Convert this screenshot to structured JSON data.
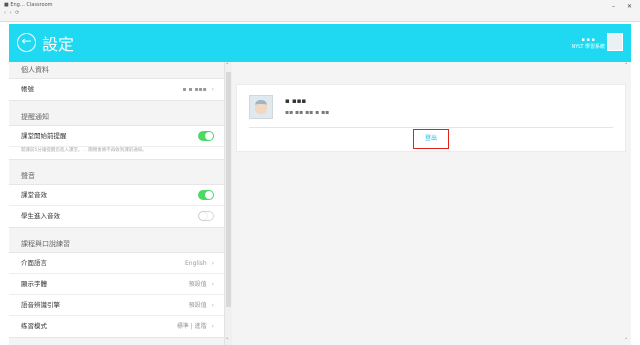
{
  "window": {
    "title": "■ Eng… Classroom",
    "nav": "‹ › ⟳",
    "buttons": [
      "–",
      "✕"
    ]
  },
  "header": {
    "title": "設定",
    "back_icon": "back-arrow-circle-icon",
    "user_line1": "▪ ▪ ▪",
    "user_line2": "NYLT 學習系統",
    "accent": "#1ed9f1"
  },
  "sidebar": {
    "sections": [
      {
        "title": "個人資料",
        "rows": [
          {
            "label": "帳號",
            "value": "▪ ▪ ▪▪▪",
            "chevron": "›"
          }
        ]
      },
      {
        "title": "提醒通知",
        "rows": [
          {
            "label": "課堂開始前提醒",
            "toggle": "on"
          }
        ],
        "description": "開課前5分鐘提醒您進入課堂。… 關閉後將不再收到課前通知。"
      },
      {
        "title": "聲音",
        "rows": [
          {
            "label": "課堂音效",
            "toggle": "on"
          },
          {
            "label": "學生進入音效",
            "toggle": "off"
          }
        ]
      },
      {
        "title": "課程與口說練習",
        "rows": [
          {
            "label": "介面語言",
            "value": "English",
            "chevron": "›"
          },
          {
            "label": "顯示字體",
            "value": "預設值",
            "chevron": "›"
          },
          {
            "label": "語音辨識引擎",
            "value": "預設值",
            "chevron": "›"
          },
          {
            "label": "练習模式",
            "value": "標準 | 進階",
            "chevron": "›"
          }
        ]
      }
    ]
  },
  "profile": {
    "name": "▪ ▪▪▪",
    "subline": "▪▪ ▪▪    ▪▪ ▪ ▪▪",
    "logout_label": "登出"
  },
  "scrollbars": {
    "up": "˄",
    "down": "˅"
  }
}
